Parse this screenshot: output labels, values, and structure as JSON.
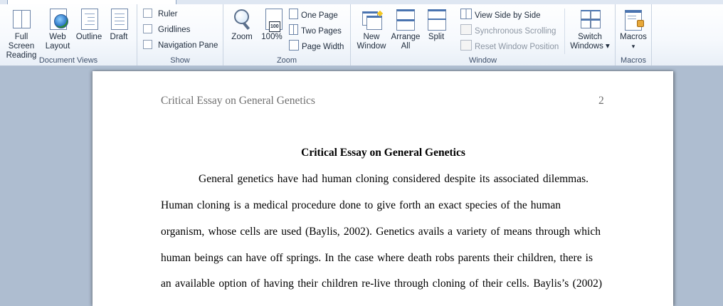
{
  "ribbon": {
    "groups": {
      "document_views": {
        "label": "Document Views",
        "buttons": [
          {
            "line1": "Full Screen",
            "line2": "Reading"
          },
          {
            "line1": "Web",
            "line2": "Layout"
          },
          {
            "line1": "Outline",
            "line2": ""
          },
          {
            "line1": "Draft",
            "line2": ""
          }
        ]
      },
      "show": {
        "label": "Show",
        "ruler": "Ruler",
        "gridlines": "Gridlines",
        "navigation_pane": "Navigation Pane"
      },
      "zoom": {
        "label": "Zoom",
        "zoom": "Zoom",
        "hundred_percent": "100%",
        "hundred_icon_text": "100",
        "one_page": "One Page",
        "two_pages": "Two Pages",
        "page_width": "Page Width"
      },
      "window": {
        "label": "Window",
        "new_window_1": "New",
        "new_window_2": "Window",
        "arrange_all_1": "Arrange",
        "arrange_all_2": "All",
        "split": "Split",
        "view_side_by_side": "View Side by Side",
        "synchronous_scrolling": "Synchronous Scrolling",
        "reset_window_position": "Reset Window Position",
        "switch_windows_1": "Switch",
        "switch_windows_2": "Windows ▾"
      },
      "macros": {
        "label": "Macros",
        "macros": "Macros",
        "dropdown": "▾"
      }
    }
  },
  "document": {
    "header_title": "Critical Essay on General Genetics",
    "page_number": "2",
    "title": "Critical Essay on General Genetics",
    "lines": [
      "General genetics have had human cloning considered despite its associated dilemmas.",
      "Human cloning is a medical procedure done to give forth an exact species of the human",
      "organism, whose cells are used (Baylis, 2002). Genetics avails a variety of means through which",
      "human beings can have off springs. In the case where death robs parents their children, there is",
      "an available option of having their children re-live through cloning of their cells. Baylis’s (2002)"
    ]
  },
  "colors": {
    "ribbon_label": "#3d4f6a",
    "doc_background": "#aebdd0",
    "header_text": "#6f6f6f"
  }
}
